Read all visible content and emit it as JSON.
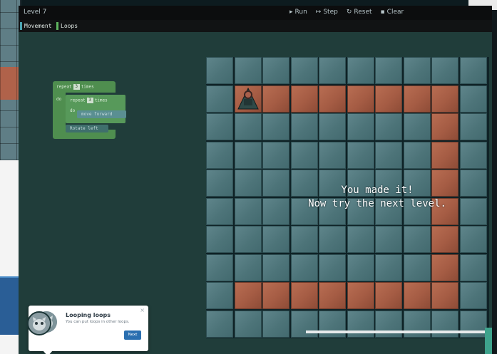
{
  "window": {
    "title": "Level 7",
    "controls": [
      {
        "label": "Run",
        "icon": "play-icon",
        "glyph": "▸"
      },
      {
        "label": "Step",
        "icon": "step-icon",
        "glyph": "↦"
      },
      {
        "label": "Reset",
        "icon": "reset-icon",
        "glyph": "↻"
      },
      {
        "label": "Clear",
        "icon": "trash-icon",
        "glyph": "▪"
      }
    ]
  },
  "toolbox": {
    "categories": [
      {
        "label": "Movement",
        "color": "#4aa3b0"
      },
      {
        "label": "Loops",
        "color": "#5fb65f"
      }
    ]
  },
  "program": {
    "outer_repeat": {
      "prefix": "repeat",
      "count": "3",
      "suffix": "times",
      "do": "do"
    },
    "inner_repeat": {
      "prefix": "repeat",
      "count": "3",
      "suffix": "times",
      "do": "do"
    },
    "move_block": "move forward",
    "rotate_block": "Rotate left"
  },
  "board": {
    "columns": 10,
    "rows": 10,
    "robot": {
      "row": 1,
      "col": 1
    },
    "path": [
      [
        1,
        1
      ],
      [
        1,
        2
      ],
      [
        1,
        3
      ],
      [
        1,
        4
      ],
      [
        1,
        5
      ],
      [
        1,
        6
      ],
      [
        1,
        7
      ],
      [
        1,
        8
      ],
      [
        2,
        8
      ],
      [
        3,
        8
      ],
      [
        4,
        8
      ],
      [
        5,
        8
      ],
      [
        6,
        8
      ],
      [
        7,
        8
      ],
      [
        8,
        8
      ],
      [
        8,
        1
      ],
      [
        8,
        2
      ],
      [
        8,
        3
      ],
      [
        8,
        4
      ],
      [
        8,
        5
      ],
      [
        8,
        6
      ],
      [
        8,
        7
      ]
    ],
    "message": {
      "line1": "You made it!",
      "line2": "Now try the next level."
    }
  },
  "hint": {
    "title": "Looping loops",
    "message": "You can put loops in other loops.",
    "button": "Next",
    "close": "×"
  },
  "colors": {
    "floor": "#4d7479",
    "path": "#a55c44",
    "loop_block": "#4f8e4f",
    "move_block": "#5a8f92",
    "hint_button": "#2a6fb0"
  }
}
